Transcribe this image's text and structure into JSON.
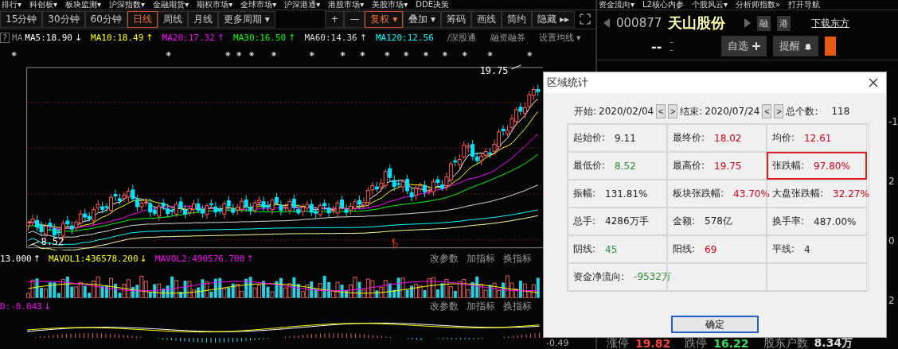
{
  "top_menu": [
    "排行▾",
    "科创板▾",
    "板块监测▾",
    "沪深指数▾",
    "金融期货▾",
    "期权市场▾",
    "全球市场▾",
    "沪深港通▾",
    "港股市场▾",
    "美股市场▾",
    "DDE决策"
  ],
  "top_menu_right": [
    "资金流向▾",
    "L2核心内参",
    "个股风云▾",
    "分析师指数»",
    "打开导航"
  ],
  "period_tabs": [
    {
      "label": "15分钟",
      "selected": false
    },
    {
      "label": "30分钟",
      "selected": false
    },
    {
      "label": "60分钟",
      "selected": false
    },
    {
      "label": "日线",
      "selected": true
    },
    {
      "label": "周线",
      "selected": false
    },
    {
      "label": "月线",
      "selected": false
    },
    {
      "label": "更多周期 ▾",
      "selected": false
    }
  ],
  "tools": [
    {
      "label": "+",
      "selected": false
    },
    {
      "label": "—",
      "selected": false
    },
    {
      "label": "复权 ▾",
      "selected": true
    },
    {
      "label": "叠加 ▾",
      "selected": false
    },
    {
      "label": "筹码",
      "selected": false
    },
    {
      "label": "画线",
      "selected": false
    },
    {
      "label": "简约",
      "selected": false
    },
    {
      "label": "隐藏 ▸▸",
      "selected": false
    }
  ],
  "ma_bar": {
    "help": "?",
    "title": "MA",
    "indicators": [
      {
        "label": "MA5:18.90",
        "arrow": "↓",
        "color": "#ffffff"
      },
      {
        "label": "MA10:18.49",
        "arrow": "↑",
        "color": "#ffff00"
      },
      {
        "label": "MA20:17.32",
        "arrow": "↑",
        "color": "#ff00ff"
      },
      {
        "label": "MA30:16.50",
        "arrow": "↑",
        "color": "#00ff00"
      },
      {
        "label": "MA60:14.36",
        "arrow": "↑",
        "color": "#dddddd"
      },
      {
        "label": "MA120:12.56",
        "color": "#00ffff"
      }
    ],
    "links": [
      "/深股通",
      "融资融券",
      "设置均线 ▾"
    ]
  },
  "chart": {
    "high_label": "19.75",
    "low_label": "8.52"
  },
  "volume_bar": {
    "indicators": [
      {
        "label": "13.000",
        "arrow": "↑",
        "color": "#ffffff"
      },
      {
        "label": "MAVOL1:436578.200",
        "arrow": "↓",
        "color": "#ffff00"
      },
      {
        "label": "MAVOL2:490576.700",
        "arrow": "↑",
        "color": "#ff00ff"
      }
    ],
    "actions": [
      "改参数",
      "加指标",
      "换指标"
    ]
  },
  "macd_bar": {
    "indicators": [
      {
        "label": "D:-0.043",
        "arrow": "↓",
        "color": "#ff00ff"
      }
    ],
    "actions": [
      "改参数",
      "加指标",
      "换指标"
    ],
    "axis_label": "-0.49"
  },
  "stock": {
    "code": "000877",
    "name": "天山股份",
    "badges": [
      "融",
      "港"
    ],
    "download_link": "下载东方",
    "price": "--",
    "change": [
      "－",
      "－"
    ],
    "buttons": [
      "自选",
      "提醒"
    ]
  },
  "side_values": [
    "-1",
    "2",
    "0",
    "2"
  ],
  "quote_row": [
    {
      "label": "涨停",
      "value": "19.82",
      "color": "#ff4040"
    },
    {
      "label": "跌停",
      "value": "16.22",
      "color": "#30e060"
    },
    {
      "label": "股东户数",
      "value": "8.34万",
      "color": "#dddddd"
    }
  ],
  "dialog": {
    "title": "区域统计",
    "start_label": "开始:",
    "start": "2020/02/04",
    "end_label": "结束:",
    "end": "2020/07/24",
    "prev": "<",
    "next": ">",
    "count_label": "总个数:",
    "count": "118",
    "rows": [
      [
        {
          "label": "起始价:",
          "value": "9.11",
          "color": "#222222",
          "highlighted": false
        },
        {
          "label": "最终价:",
          "value": "18.02",
          "color": "#d0021b",
          "highlighted": false
        },
        {
          "label": "均价:",
          "value": "12.61",
          "color": "#d0021b",
          "highlighted": false
        }
      ],
      [
        {
          "label": "最低价:",
          "value": "8.52",
          "color": "#2e8b3c",
          "highlighted": false
        },
        {
          "label": "最高价:",
          "value": "19.75",
          "color": "#d0021b",
          "highlighted": false
        },
        {
          "label": "张跌幅:",
          "value": "97.80%",
          "color": "#d0021b",
          "highlighted": true
        }
      ],
      [
        {
          "label": "振幅:",
          "value": "131.81%",
          "color": "#222222",
          "highlighted": false
        },
        {
          "label": "板块张跌幅:",
          "value": "43.70%",
          "color": "#d0021b",
          "highlighted": false
        },
        {
          "label": "大盘张跌幅:",
          "value": "32.27%",
          "color": "#d0021b",
          "highlighted": false
        }
      ],
      [
        {
          "label": "总手:",
          "value": "4286万手",
          "color": "#222222",
          "highlighted": false
        },
        {
          "label": "金额:",
          "value": "578亿",
          "color": "#222222",
          "highlighted": false
        },
        {
          "label": "换手率:",
          "value": "487.00%",
          "color": "#222222",
          "highlighted": false
        }
      ],
      [
        {
          "label": "阴线:",
          "value": "45",
          "color": "#2e8b3c",
          "highlighted": false
        },
        {
          "label": "阳线:",
          "value": "69",
          "color": "#d0021b",
          "highlighted": false
        },
        {
          "label": "平线:",
          "value": "4",
          "color": "#222222",
          "highlighted": false
        }
      ],
      [
        {
          "label": "资金净流向:",
          "value": "-9532万",
          "color": "#2e8b3c",
          "highlighted": false
        }
      ]
    ],
    "ok_button": "确定"
  }
}
